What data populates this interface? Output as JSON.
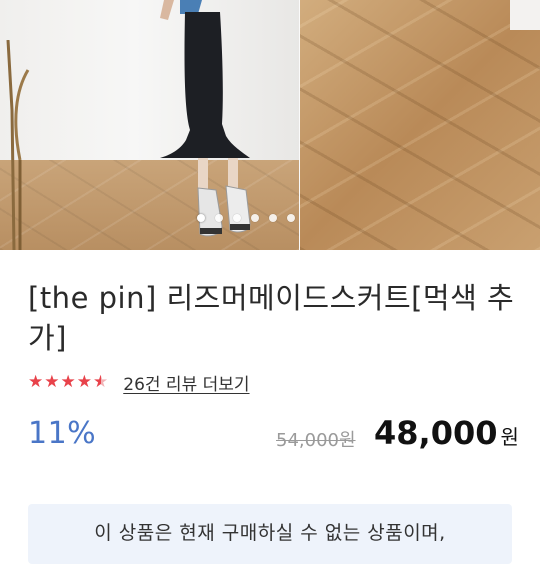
{
  "gallery": {
    "slide_count": 6,
    "active_index": 0,
    "image_alt": "product-photo"
  },
  "product": {
    "title": "[the pin] 리즈머메이드스커트[먹색 추가]",
    "rating_value": 4.5,
    "rating_max": 5,
    "review_link": "26건 리뷰 더보기",
    "discount": "11%",
    "original_price": "54,000원",
    "price": "48,000",
    "currency": "원"
  },
  "notice": {
    "text": "이 상품은 현재 구매하실 수 없는 상품이며,"
  },
  "colors": {
    "star": "#e8424a",
    "discount": "#4a76c7",
    "notice_bg": "#eef3fb"
  }
}
